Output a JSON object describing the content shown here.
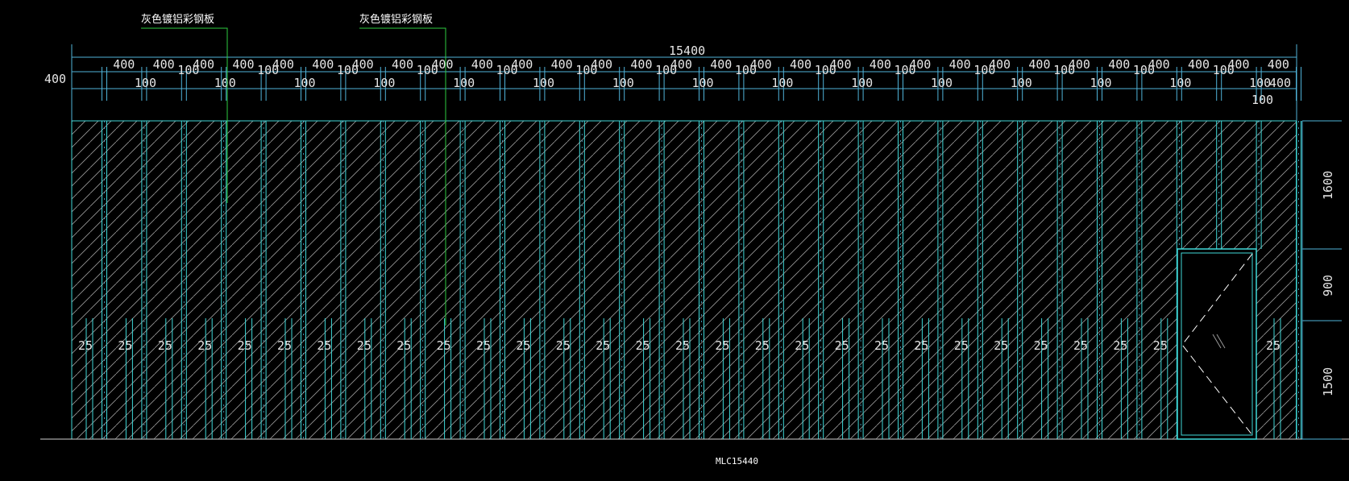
{
  "drawing": {
    "callouts": [
      {
        "text": "灰色镀铝彩钢板"
      },
      {
        "text": "灰色镀铝彩钢板"
      }
    ],
    "caption": "MLC15440",
    "dims": {
      "overall": "15400",
      "left_offset": "400",
      "segment_wide": "400",
      "segment_narrow": "100",
      "right_top": "400",
      "right_bottom": "100",
      "gap_label": "25",
      "heights": [
        "1600",
        "900",
        "1500"
      ]
    },
    "colors": {
      "background": "#000000",
      "panel_line": "#3fd9d9",
      "hatch": "#9a9a9a",
      "dimension": "#4fb3d9",
      "callout": "#2ecc40",
      "text": "#ffffff",
      "door": "#3fd9d9",
      "door_swing": "#ffffff"
    }
  }
}
